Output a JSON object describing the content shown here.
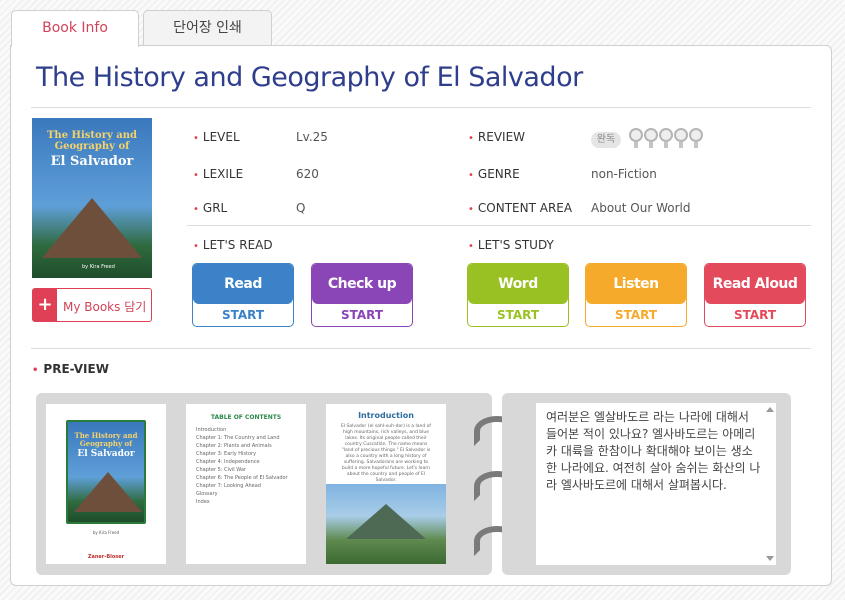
{
  "tabs": {
    "book_info": "Book Info",
    "print_words": "단어장 인쇄"
  },
  "title": "The History and Geography of El Salvador",
  "cover": {
    "line1": "The History and",
    "line2": "Geography of",
    "line3": "El Salvador",
    "author": "by Kira Freed"
  },
  "my_books": "My Books 담기",
  "meta": {
    "level_label": "LEVEL",
    "level": "Lv.25",
    "lexile_label": "LEXILE",
    "lexile": "620",
    "grl_label": "GRL",
    "grl": "Q",
    "review_label": "REVIEW",
    "review_badge": "완독",
    "genre_label": "GENRE",
    "genre": "non-Fiction",
    "content_label": "CONTENT AREA",
    "content": "About Our World"
  },
  "review_rating": 0,
  "lets_read": "LET'S READ",
  "lets_study": "LET'S STUDY",
  "actions": [
    {
      "label": "Read",
      "start": "START",
      "color": "#3b82c8"
    },
    {
      "label": "Check up",
      "start": "START",
      "color": "#8a45b7"
    },
    {
      "label": "Word",
      "start": "START",
      "color": "#9ac123"
    },
    {
      "label": "Listen",
      "start": "START",
      "color": "#f5aa2b"
    },
    {
      "label": "Read Aloud",
      "start": "START",
      "color": "#e34a5c"
    }
  ],
  "preview_label": "PRE-VIEW",
  "preview_pages": {
    "toc_title": "TABLE OF CONTENTS",
    "toc_lines": [
      "Introduction",
      "Chapter 1: The Country and Land",
      "Chapter 2: Plants and Animals",
      "Chapter 3: Early History",
      "Chapter 4: Independence",
      "Chapter 5: Civil War",
      "Chapter 6: The People of El Salvador",
      "Chapter 7: Looking Ahead",
      "Glossary",
      "Index"
    ],
    "intro_title": "Introduction",
    "intro_text": "El Salvador (el sahl-vuh-dor) is a land of high mountains, rich valleys, and blue lakes. Its original people called their country Cuscatlán. The name means \"land of precious things.\" El Salvador is also a country with a long history of suffering. Salvadorans are working to build a more hopeful future. Let's learn about the country and people of El Salvador.",
    "publisher": "Zaner-Bloser"
  },
  "description": "여러분은 엘살바도르 라는 나라에 대해서 들어본 적이 있나요? 엘사바도르는 아메리카 대륙을 한참이나 확대해야 보이는 생소한 나라에요. 여전히 살아 숨쉬는 화산의 나라 엘사바도르에 대해서 살펴봅시다."
}
